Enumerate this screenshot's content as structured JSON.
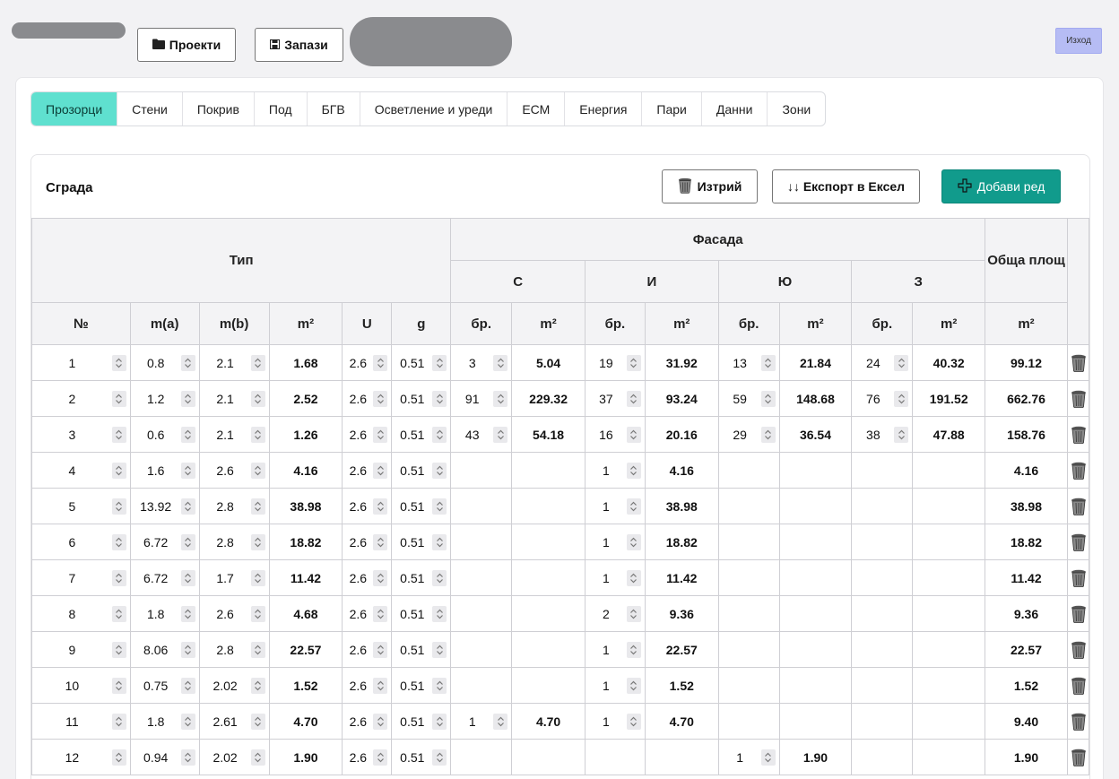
{
  "header": {
    "projects_label": "Проекти",
    "save_label": "Запази",
    "logout_label": "Изход"
  },
  "tabs": [
    {
      "label": "Прозорци",
      "active": true
    },
    {
      "label": "Стени",
      "active": false
    },
    {
      "label": "Покрив",
      "active": false
    },
    {
      "label": "Под",
      "active": false
    },
    {
      "label": "БГВ",
      "active": false
    },
    {
      "label": "Осветление и уреди",
      "active": false
    },
    {
      "label": "ЕСМ",
      "active": false
    },
    {
      "label": "Енергия",
      "active": false
    },
    {
      "label": "Пари",
      "active": false
    },
    {
      "label": "Данни",
      "active": false
    },
    {
      "label": "Зони",
      "active": false
    }
  ],
  "section": {
    "title": "Сграда",
    "delete_label": "Изтрий",
    "export_label": "↓↓ Експорт в Ексел",
    "add_label": "Добави ред"
  },
  "table": {
    "group_type": "Тип",
    "group_facade": "Фасада",
    "group_total": "Обща площ",
    "facades": [
      "С",
      "И",
      "Ю",
      "З"
    ],
    "col_headers": [
      "№",
      "m(a)",
      "m(b)",
      "m²",
      "U",
      "g",
      "бр.",
      "m²",
      "бр.",
      "m²",
      "бр.",
      "m²",
      "бр.",
      "m²",
      "m²"
    ],
    "rows": [
      {
        "no": "1",
        "a": "0.8",
        "b": "2.1",
        "area": "1.68",
        "u": "2.6",
        "g": "0.51",
        "s_cnt": "3",
        "s_m2": "5.04",
        "i_cnt": "19",
        "i_m2": "31.92",
        "yu_cnt": "13",
        "yu_m2": "21.84",
        "z_cnt": "24",
        "z_m2": "40.32",
        "total": "99.12"
      },
      {
        "no": "2",
        "a": "1.2",
        "b": "2.1",
        "area": "2.52",
        "u": "2.6",
        "g": "0.51",
        "s_cnt": "91",
        "s_m2": "229.32",
        "i_cnt": "37",
        "i_m2": "93.24",
        "yu_cnt": "59",
        "yu_m2": "148.68",
        "z_cnt": "76",
        "z_m2": "191.52",
        "total": "662.76"
      },
      {
        "no": "3",
        "a": "0.6",
        "b": "2.1",
        "area": "1.26",
        "u": "2.6",
        "g": "0.51",
        "s_cnt": "43",
        "s_m2": "54.18",
        "i_cnt": "16",
        "i_m2": "20.16",
        "yu_cnt": "29",
        "yu_m2": "36.54",
        "z_cnt": "38",
        "z_m2": "47.88",
        "total": "158.76"
      },
      {
        "no": "4",
        "a": "1.6",
        "b": "2.6",
        "area": "4.16",
        "u": "2.6",
        "g": "0.51",
        "s_cnt": "",
        "s_m2": "",
        "i_cnt": "1",
        "i_m2": "4.16",
        "yu_cnt": "",
        "yu_m2": "",
        "z_cnt": "",
        "z_m2": "",
        "total": "4.16"
      },
      {
        "no": "5",
        "a": "13.92",
        "b": "2.8",
        "area": "38.98",
        "u": "2.6",
        "g": "0.51",
        "s_cnt": "",
        "s_m2": "",
        "i_cnt": "1",
        "i_m2": "38.98",
        "yu_cnt": "",
        "yu_m2": "",
        "z_cnt": "",
        "z_m2": "",
        "total": "38.98"
      },
      {
        "no": "6",
        "a": "6.72",
        "b": "2.8",
        "area": "18.82",
        "u": "2.6",
        "g": "0.51",
        "s_cnt": "",
        "s_m2": "",
        "i_cnt": "1",
        "i_m2": "18.82",
        "yu_cnt": "",
        "yu_m2": "",
        "z_cnt": "",
        "z_m2": "",
        "total": "18.82"
      },
      {
        "no": "7",
        "a": "6.72",
        "b": "1.7",
        "area": "11.42",
        "u": "2.6",
        "g": "0.51",
        "s_cnt": "",
        "s_m2": "",
        "i_cnt": "1",
        "i_m2": "11.42",
        "yu_cnt": "",
        "yu_m2": "",
        "z_cnt": "",
        "z_m2": "",
        "total": "11.42"
      },
      {
        "no": "8",
        "a": "1.8",
        "b": "2.6",
        "area": "4.68",
        "u": "2.6",
        "g": "0.51",
        "s_cnt": "",
        "s_m2": "",
        "i_cnt": "2",
        "i_m2": "9.36",
        "yu_cnt": "",
        "yu_m2": "",
        "z_cnt": "",
        "z_m2": "",
        "total": "9.36"
      },
      {
        "no": "9",
        "a": "8.06",
        "b": "2.8",
        "area": "22.57",
        "u": "2.6",
        "g": "0.51",
        "s_cnt": "",
        "s_m2": "",
        "i_cnt": "1",
        "i_m2": "22.57",
        "yu_cnt": "",
        "yu_m2": "",
        "z_cnt": "",
        "z_m2": "",
        "total": "22.57"
      },
      {
        "no": "10",
        "a": "0.75",
        "b": "2.02",
        "area": "1.52",
        "u": "2.6",
        "g": "0.51",
        "s_cnt": "",
        "s_m2": "",
        "i_cnt": "1",
        "i_m2": "1.52",
        "yu_cnt": "",
        "yu_m2": "",
        "z_cnt": "",
        "z_m2": "",
        "total": "1.52"
      },
      {
        "no": "11",
        "a": "1.8",
        "b": "2.61",
        "area": "4.70",
        "u": "2.6",
        "g": "0.51",
        "s_cnt": "1",
        "s_m2": "4.70",
        "i_cnt": "1",
        "i_m2": "4.70",
        "yu_cnt": "",
        "yu_m2": "",
        "z_cnt": "",
        "z_m2": "",
        "total": "9.40"
      },
      {
        "no": "12",
        "a": "0.94",
        "b": "2.02",
        "area": "1.90",
        "u": "2.6",
        "g": "0.51",
        "s_cnt": "",
        "s_m2": "",
        "i_cnt": "",
        "i_m2": "",
        "yu_cnt": "1",
        "yu_m2": "1.90",
        "z_cnt": "",
        "z_m2": "",
        "total": "1.90"
      }
    ]
  },
  "icons": {
    "folder": "folder-icon",
    "save": "floppy-disk-icon",
    "trash": "trash-can-icon",
    "plus": "plus-icon",
    "spinner": "chevron-up-down-icon"
  },
  "colors": {
    "active_tab": "#5fe0cf",
    "add_button": "#119b8c",
    "logout_button": "#b6bcf4"
  }
}
